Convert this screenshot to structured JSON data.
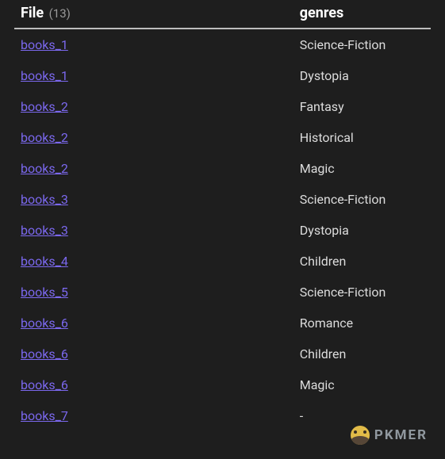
{
  "table": {
    "header": {
      "file_label": "File",
      "file_count": "(13)",
      "genre_label": "genres"
    },
    "rows": [
      {
        "file": "books_1",
        "genre": "Science-Fiction"
      },
      {
        "file": "books_1",
        "genre": "Dystopia"
      },
      {
        "file": "books_2",
        "genre": "Fantasy"
      },
      {
        "file": "books_2",
        "genre": "Historical"
      },
      {
        "file": "books_2",
        "genre": "Magic"
      },
      {
        "file": "books_3",
        "genre": "Science-Fiction"
      },
      {
        "file": "books_3",
        "genre": "Dystopia"
      },
      {
        "file": "books_4",
        "genre": "Children"
      },
      {
        "file": "books_5",
        "genre": "Science-Fiction"
      },
      {
        "file": "books_6",
        "genre": "Romance"
      },
      {
        "file": "books_6",
        "genre": "Children"
      },
      {
        "file": "books_6",
        "genre": "Magic"
      },
      {
        "file": "books_7",
        "genre": "-"
      }
    ]
  },
  "watermark": {
    "text": "PKMER"
  }
}
